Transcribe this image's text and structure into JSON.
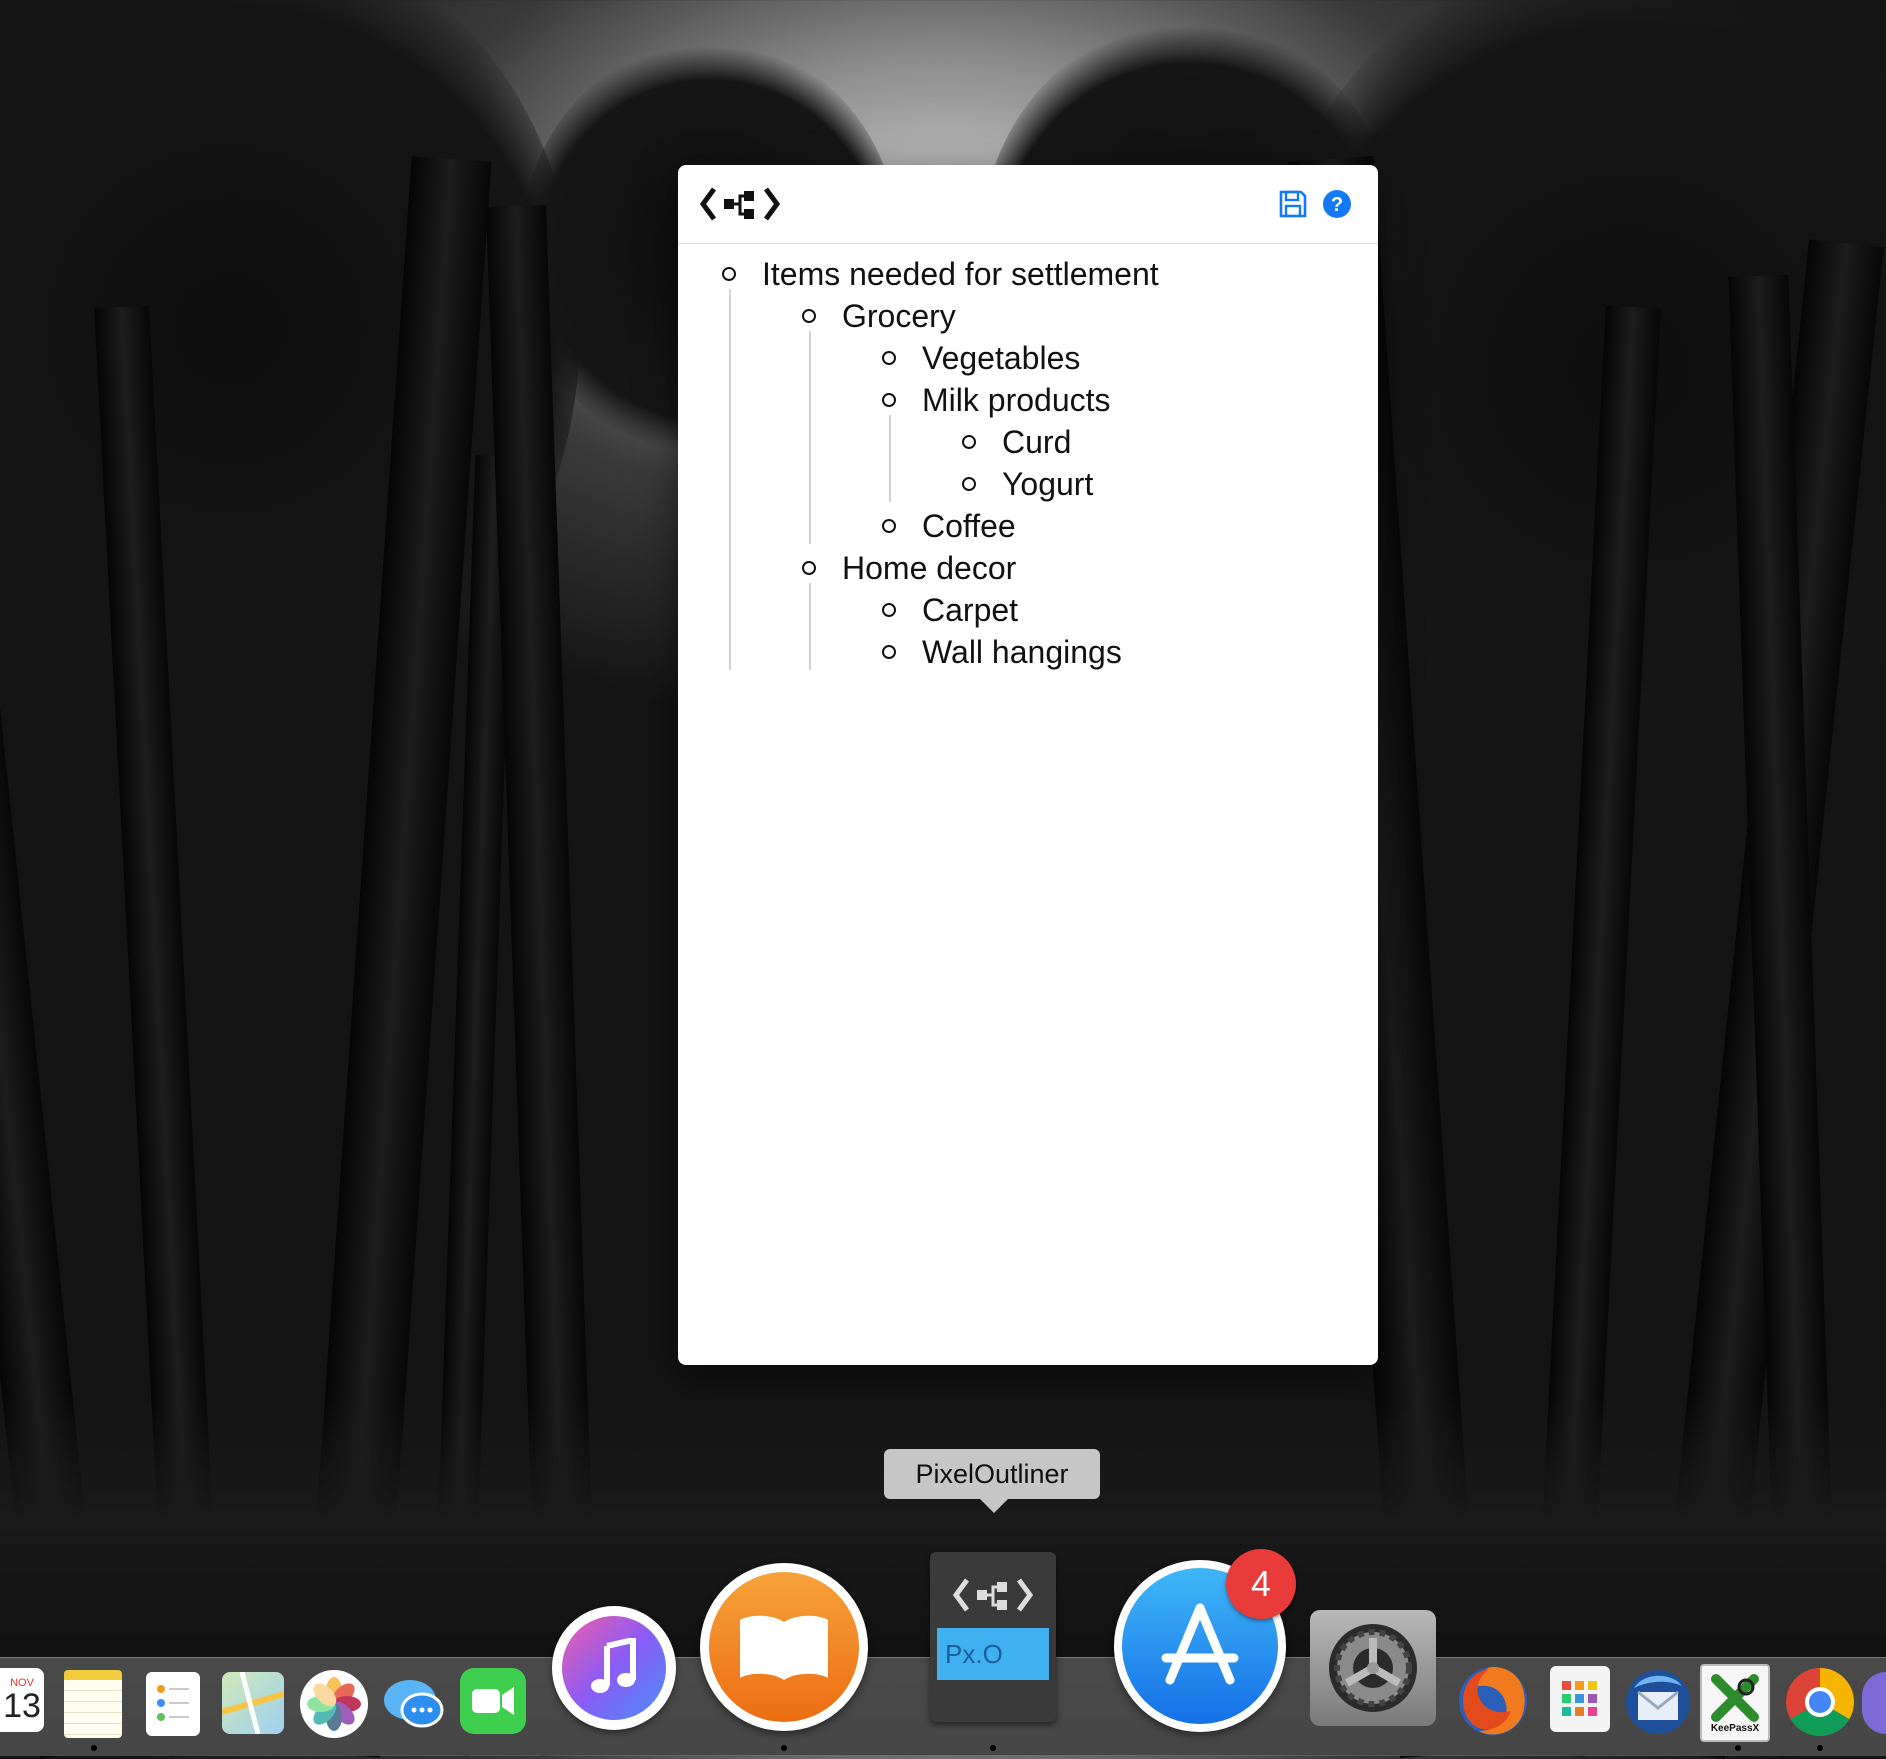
{
  "window": {
    "logo_icon": "pixeloutliner-logo-icon",
    "save_icon": "save-icon",
    "help_icon": "help-icon",
    "accent_color": "#1479f5"
  },
  "outline": {
    "items": [
      {
        "label": "Items needed for settlement",
        "level": 0
      },
      {
        "label": "Grocery",
        "level": 1
      },
      {
        "label": "Vegetables",
        "level": 2
      },
      {
        "label": "Milk products",
        "level": 2
      },
      {
        "label": "Curd",
        "level": 3
      },
      {
        "label": "Yogurt",
        "level": 3
      },
      {
        "label": "Coffee",
        "level": 2
      },
      {
        "label": "Home decor",
        "level": 1
      },
      {
        "label": "Carpet",
        "level": 2
      },
      {
        "label": "Wall hangings",
        "level": 2
      }
    ]
  },
  "tooltip": {
    "text": "PixelOutliner"
  },
  "dock": {
    "calendar": {
      "month": "NOV",
      "day": "13"
    },
    "pixeloutliner_label": "Px.O",
    "app_store_badge": "4",
    "keepassx_label": "KeePassX",
    "apps": [
      "calendar",
      "notes",
      "reminders",
      "maps",
      "photos",
      "messages",
      "facetime",
      "itunes",
      "ibooks",
      "pixeloutliner",
      "app-store",
      "system-preferences",
      "firefox",
      "launchpad",
      "thunderbird",
      "keepassx",
      "chrome"
    ]
  }
}
